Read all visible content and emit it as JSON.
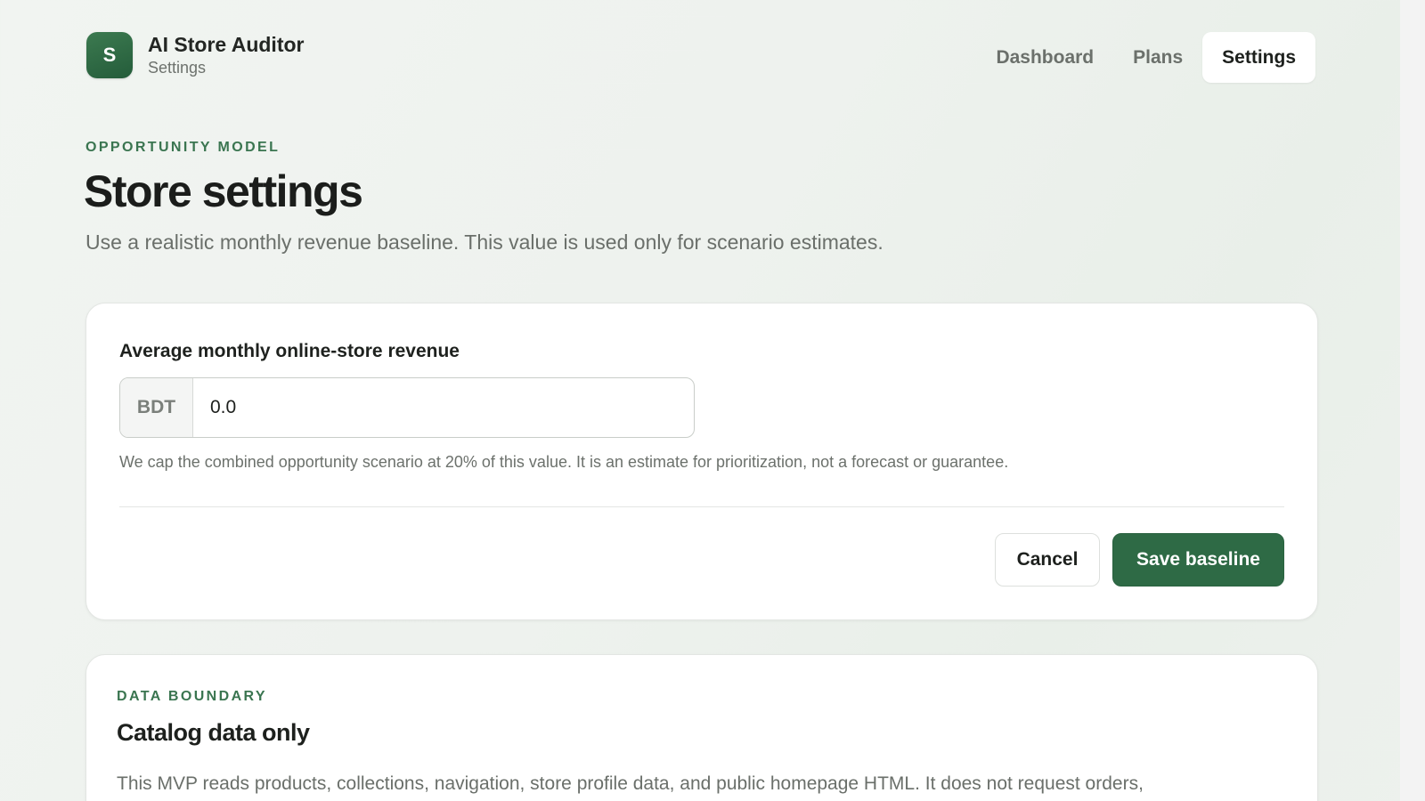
{
  "app": {
    "logo_letter": "S",
    "title": "AI Store Auditor",
    "subtitle": "Settings"
  },
  "nav": {
    "items": [
      {
        "label": "Dashboard",
        "active": false
      },
      {
        "label": "Plans",
        "active": false
      },
      {
        "label": "Settings",
        "active": true
      }
    ]
  },
  "hero": {
    "eyebrow": "OPPORTUNITY MODEL",
    "title": "Store settings",
    "description": "Use a realistic monthly revenue baseline. This value is used only for scenario estimates."
  },
  "revenue_card": {
    "label": "Average monthly online-store revenue",
    "currency": "BDT",
    "value": "0.0",
    "help": "We cap the combined opportunity scenario at 20% of this value. It is an estimate for prioritization, not a forecast or guarantee.",
    "cancel_label": "Cancel",
    "save_label": "Save baseline"
  },
  "boundary_card": {
    "eyebrow": "DATA BOUNDARY",
    "title": "Catalog data only",
    "text": "This MVP reads products, collections, navigation, store profile data, and public homepage HTML. It does not request orders,"
  },
  "colors": {
    "accent": "#2e6a45",
    "eyebrow": "#3a7550",
    "background": "#eef2ee"
  }
}
